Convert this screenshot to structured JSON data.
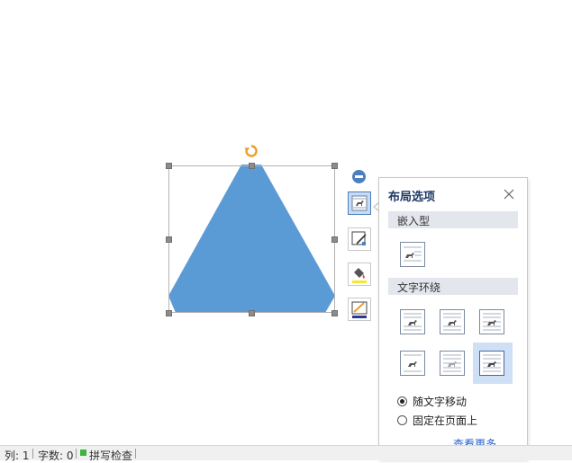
{
  "shape": {
    "fill": "#5b9bd5"
  },
  "layout_panel": {
    "title": "布局选项",
    "inline_section": "嵌入型",
    "wrap_section": "文字环绕",
    "options": {
      "move_with_text": "随文字移动",
      "fix_position": "固定在页面上",
      "selected": "move_with_text"
    },
    "more_link": "查看更多...",
    "accent_color": "#4a7fc0"
  },
  "statusbar": {
    "column": "列: 1",
    "word_count": "字数: 0",
    "spell_check": "拼写检查"
  }
}
